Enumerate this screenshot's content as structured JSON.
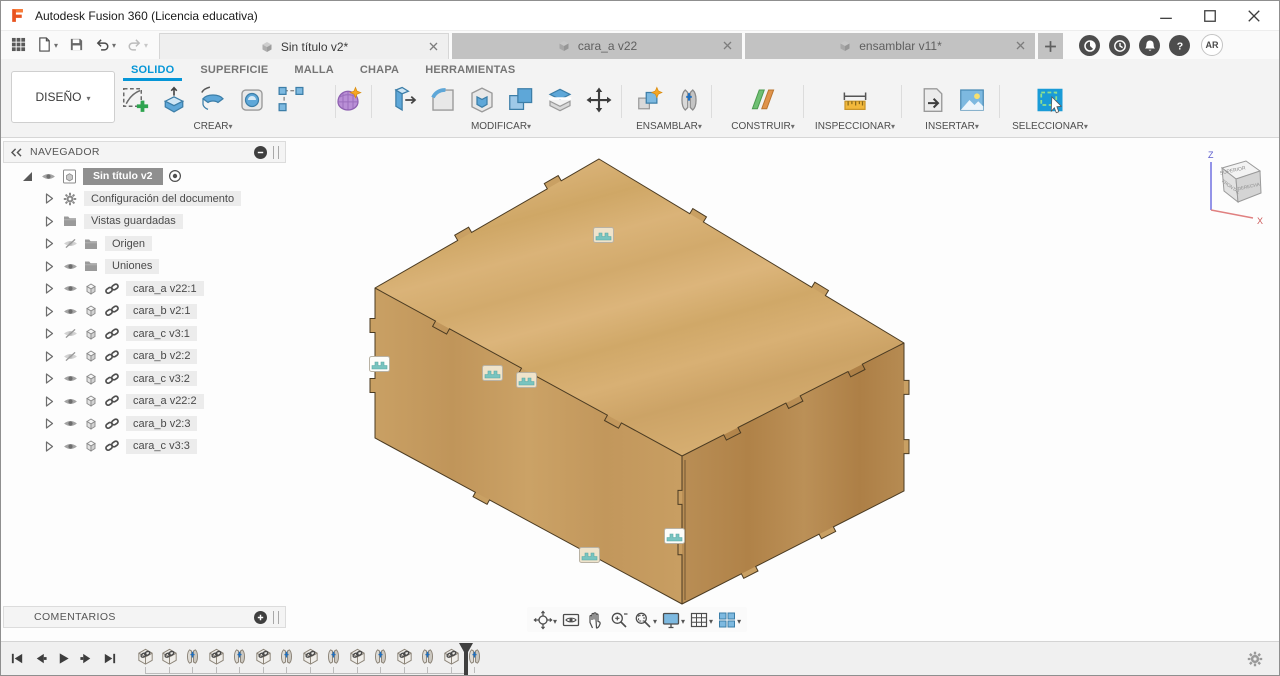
{
  "window": {
    "title": "Autodesk Fusion 360 (Licencia educativa)"
  },
  "quick_toolbar": {
    "items": [
      {
        "icon": "app-grid",
        "caret": false,
        "disabled": false
      },
      {
        "icon": "file-new",
        "caret": true,
        "disabled": false
      },
      {
        "icon": "save",
        "caret": false,
        "disabled": false
      },
      {
        "icon": "undo",
        "caret": true,
        "disabled": false
      },
      {
        "icon": "redo",
        "caret": true,
        "disabled": true
      }
    ]
  },
  "document_tabs": [
    {
      "label": "Sin título v2*",
      "active": true
    },
    {
      "label": "cara_a v22",
      "active": false
    },
    {
      "label": "ensamblar v11*",
      "active": false
    }
  ],
  "title_icons": [
    "job-status",
    "recent-documents",
    "notifications",
    "help"
  ],
  "account": {
    "avatar": "AR"
  },
  "ribbon": {
    "workspace_label": "DISEÑO",
    "tabs": [
      {
        "label": "SOLIDO",
        "active": true
      },
      {
        "label": "SUPERFICIE",
        "active": false
      },
      {
        "label": "MALLA",
        "active": false
      },
      {
        "label": "CHAPA",
        "active": false
      },
      {
        "label": "HERRAMIENTAS",
        "active": false
      }
    ],
    "groups": [
      {
        "label": "CREAR",
        "icons": [
          "create-sketch",
          "extrude",
          "revolve",
          "hole",
          "rectangular-pattern"
        ]
      },
      {
        "label": "",
        "icons": [
          "create-form"
        ]
      },
      {
        "label": "MODIFICAR",
        "icons": [
          "press-pull",
          "fillet",
          "shell",
          "combine",
          "split-body",
          "move-copy"
        ]
      },
      {
        "label": "ENSAMBLAR",
        "icons": [
          "new-component",
          "joint"
        ]
      },
      {
        "label": "CONSTRUIR",
        "icons": [
          "construction-plane"
        ]
      },
      {
        "label": "INSPECCIONAR",
        "icons": [
          "measure"
        ]
      },
      {
        "label": "INSERTAR",
        "icons": [
          "insert-derive",
          "insert-canvas"
        ]
      },
      {
        "label": "SELECCIONAR",
        "icons": [
          "select-window"
        ]
      }
    ]
  },
  "navigator": {
    "header": "NAVEGADOR",
    "root": {
      "label": "Sin título v2"
    },
    "items": [
      {
        "label": "Configuración del documento",
        "icon": "gear",
        "eye": null,
        "link": false
      },
      {
        "label": "Vistas guardadas",
        "icon": "folder",
        "eye": null,
        "link": false
      },
      {
        "label": "Origen",
        "icon": "folder",
        "eye": "hidden",
        "link": false
      },
      {
        "label": "Uniones",
        "icon": "folder",
        "eye": "visible",
        "link": false
      },
      {
        "label": "cara_a v22:1",
        "icon": "component",
        "eye": "visible",
        "link": true
      },
      {
        "label": "cara_b v2:1",
        "icon": "component",
        "eye": "visible",
        "link": true
      },
      {
        "label": "cara_c v3:1",
        "icon": "component",
        "eye": "hidden",
        "link": true
      },
      {
        "label": "cara_b v2:2",
        "icon": "component",
        "eye": "hidden",
        "link": true
      },
      {
        "label": "cara_c v3:2",
        "icon": "component",
        "eye": "visible",
        "link": true
      },
      {
        "label": "cara_a v22:2",
        "icon": "component",
        "eye": "visible",
        "link": true
      },
      {
        "label": "cara_b v2:3",
        "icon": "component",
        "eye": "visible",
        "link": true
      },
      {
        "label": "cara_c v3:3",
        "icon": "component",
        "eye": "visible",
        "link": true
      }
    ]
  },
  "comments": {
    "header": "COMENTARIOS"
  },
  "viewcube": {
    "z_label": "Z",
    "x_label": "X",
    "faces": {
      "top": "SUPERIOR",
      "left": "FRONTAL",
      "right": "DERECHA"
    }
  },
  "canvas_toolbar": [
    {
      "icon": "orbit",
      "caret": true
    },
    {
      "icon": "look-at",
      "caret": false
    },
    {
      "icon": "pan",
      "caret": false
    },
    {
      "icon": "zoom",
      "caret": false
    },
    {
      "icon": "fit",
      "caret": true
    },
    {
      "icon": "display-settings",
      "caret": true
    },
    {
      "icon": "layout-grid",
      "caret": true
    },
    {
      "icon": "viewports",
      "caret": true
    }
  ],
  "canvas": {
    "joint_markers": 6
  },
  "timeline": {
    "playback": [
      "go-to-start",
      "step-back",
      "play",
      "step-forward",
      "go-to-end"
    ],
    "features": [
      "component",
      "component",
      "joint",
      "component",
      "joint",
      "component",
      "joint",
      "component",
      "joint",
      "component",
      "joint",
      "component",
      "joint",
      "component",
      "joint"
    ]
  },
  "colors": {
    "accent": "#0696d7",
    "wood_top": "#d4ac6e",
    "wood_left": "#c79e62",
    "wood_right": "#b78c55",
    "tab_active": "#efefef",
    "tab_inactive": "#c2c2c2",
    "joint_glyph_teal": "#79c4c0"
  }
}
